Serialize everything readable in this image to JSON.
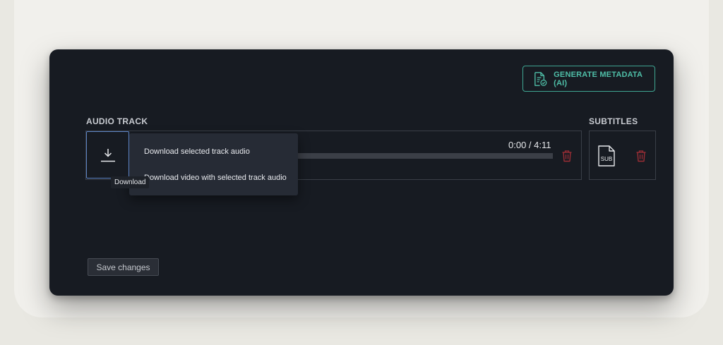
{
  "header": {
    "generate_button_label": "GENERATE METADATA (AI)"
  },
  "audio_track": {
    "section_label": "AUDIO TRACK",
    "time_display": "0:00 / 4:11",
    "progress": 0
  },
  "subtitles": {
    "section_label": "SUBTITLES",
    "file_icon_label": "SUB"
  },
  "download_menu": {
    "items": [
      {
        "label": "Download selected track audio"
      },
      {
        "label": "Download video with selected track audio"
      }
    ],
    "tooltip": "Download"
  },
  "footer": {
    "save_label": "Save changes"
  },
  "colors": {
    "panel_bg": "#171b22",
    "accent_teal": "#4fbfa8",
    "danger_red": "#9b2d35",
    "focus_blue": "#5b82c2"
  }
}
